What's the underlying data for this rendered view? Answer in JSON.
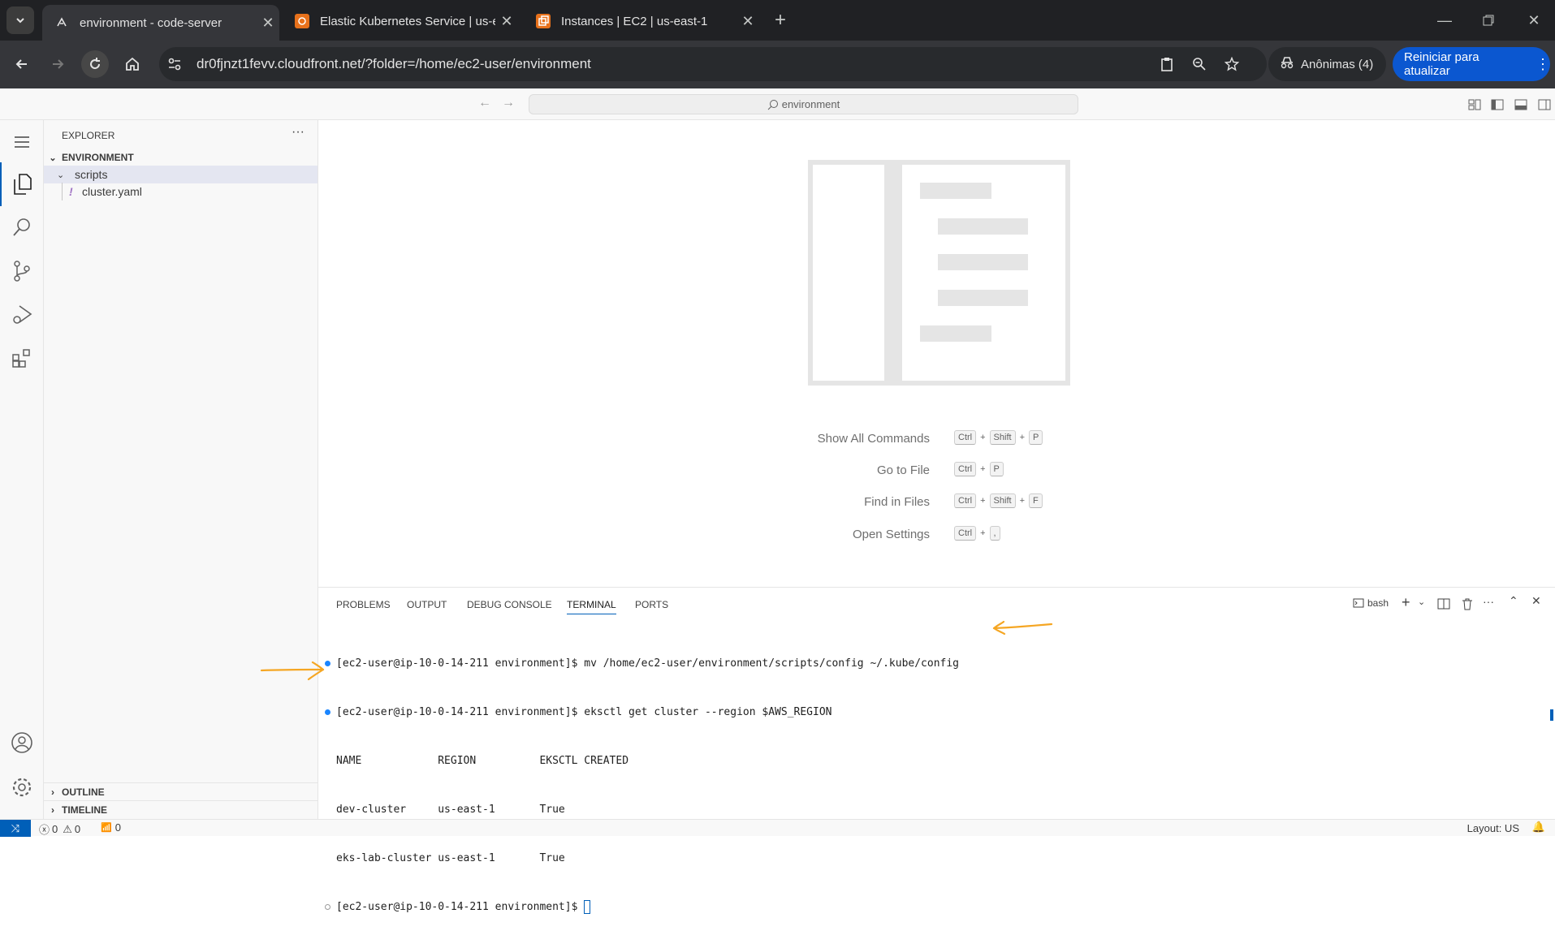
{
  "browser": {
    "tabs": [
      {
        "title": "environment - code-server",
        "active": true
      },
      {
        "title": "Elastic Kubernetes Service | us-e",
        "active": false
      },
      {
        "title": "Instances | EC2 | us-east-1",
        "active": false
      }
    ],
    "url": "dr0fjnzt1fevv.cloudfront.net/?folder=/home/ec2-user/environment",
    "incognito_label": "Anônimas (4)",
    "update_label": "Reiniciar para atualizar"
  },
  "vscode": {
    "command_center": "environment",
    "explorer": {
      "title": "EXPLORER",
      "root": "ENVIRONMENT",
      "folder": "scripts",
      "file": "cluster.yaml",
      "file_icon": "!",
      "outline": "OUTLINE",
      "timeline": "TIMELINE"
    },
    "shortcuts": [
      {
        "label": "Show All Commands",
        "keys": [
          "Ctrl",
          "Shift",
          "P"
        ]
      },
      {
        "label": "Go to File",
        "keys": [
          "Ctrl",
          "P"
        ]
      },
      {
        "label": "Find in Files",
        "keys": [
          "Ctrl",
          "Shift",
          "F"
        ]
      },
      {
        "label": "Open Settings",
        "keys": [
          "Ctrl",
          ","
        ]
      }
    ],
    "panel_tabs": [
      "PROBLEMS",
      "OUTPUT",
      "DEBUG CONSOLE",
      "TERMINAL",
      "PORTS"
    ],
    "active_panel_tab": "TERMINAL",
    "terminal_shell": "bash",
    "terminal_lines": [
      "[ec2-user@ip-10-0-14-211 environment]$ mv /home/ec2-user/environment/scripts/config ~/.kube/config",
      "[ec2-user@ip-10-0-14-211 environment]$ eksctl get cluster --region $AWS_REGION",
      "NAME            REGION          EKSCTL CREATED",
      "dev-cluster     us-east-1       True",
      "eks-lab-cluster us-east-1       True",
      "[ec2-user@ip-10-0-14-211 environment]$ "
    ],
    "status": {
      "errors": "0",
      "warnings": "0",
      "ports": "0",
      "layout": "Layout: US"
    },
    "colors": {
      "accent": "#005fb8",
      "arrow": "#f5a623"
    }
  }
}
